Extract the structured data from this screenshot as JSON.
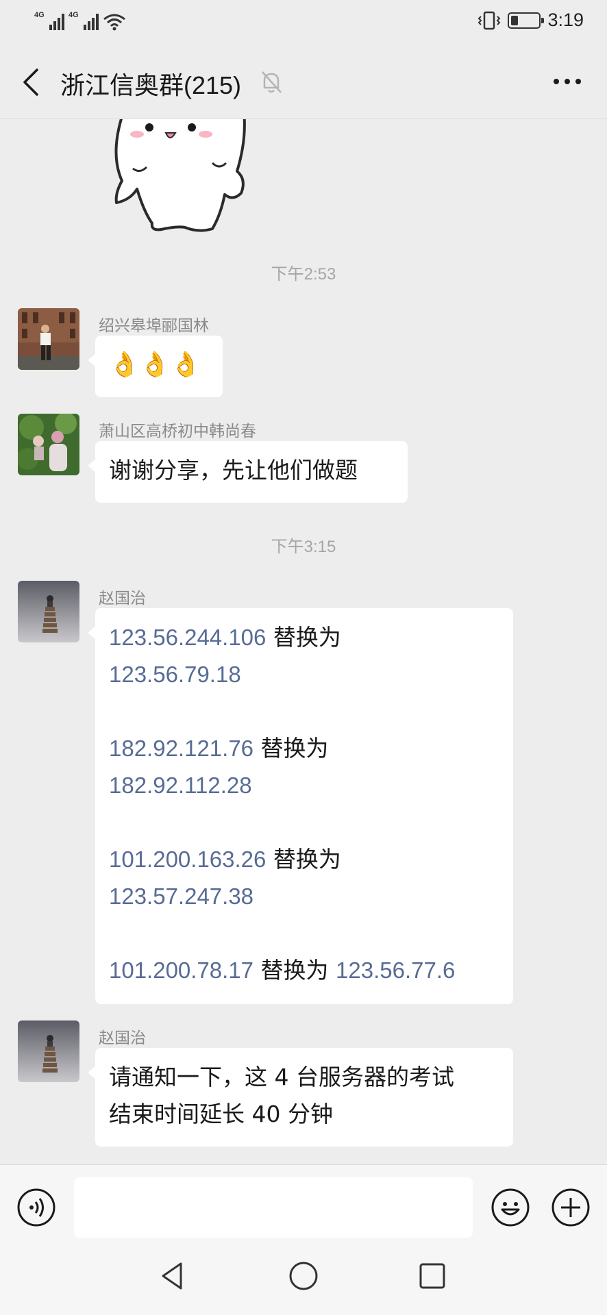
{
  "status": {
    "network1": "4G",
    "network2": "4G",
    "time": "3:19",
    "battery_level_percent": 25
  },
  "header": {
    "title": "浙江信奥群(215)"
  },
  "messages": [
    {
      "type": "time",
      "text": "下午2:53"
    },
    {
      "type": "msg",
      "sender": "绍兴皋埠郦国林",
      "text": "👌👌👌"
    },
    {
      "type": "msg",
      "sender": "萧山区高桥初中韩尚春",
      "text": "谢谢分享，先让他们做题"
    },
    {
      "type": "time",
      "text": "下午3:15"
    },
    {
      "type": "msg",
      "sender": "赵国治",
      "replacements": [
        {
          "old": "123.56.244.106",
          "word": "替换为",
          "new": "123.56.79.18"
        },
        {
          "old": "182.92.121.76",
          "word": "替换为",
          "new": "182.92.112.28"
        },
        {
          "old": "101.200.163.26",
          "word": "替换为",
          "new": "123.57.247.38"
        },
        {
          "old": "101.200.78.17",
          "word": "替换为",
          "new": "123.56.77.6"
        }
      ]
    },
    {
      "type": "msg",
      "sender": "赵国治",
      "lines": [
        "请通知一下，这 4 台服务器的考试",
        "结束时间延长 40 分钟"
      ]
    }
  ],
  "input": {
    "value": ""
  },
  "icons": {
    "back": "chevron-left-icon",
    "mute": "bell-off-icon",
    "more": "more-dots-icon",
    "voice": "voice-icon",
    "emoji": "emoji-icon",
    "plus": "plus-icon",
    "nav_back": "triangle-back-icon",
    "nav_home": "circle-home-icon",
    "nav_recent": "square-recent-icon"
  },
  "colors": {
    "background": "#ededed",
    "bubble": "#ffffff",
    "link": "#576b95",
    "meta": "#8a8a8a"
  }
}
